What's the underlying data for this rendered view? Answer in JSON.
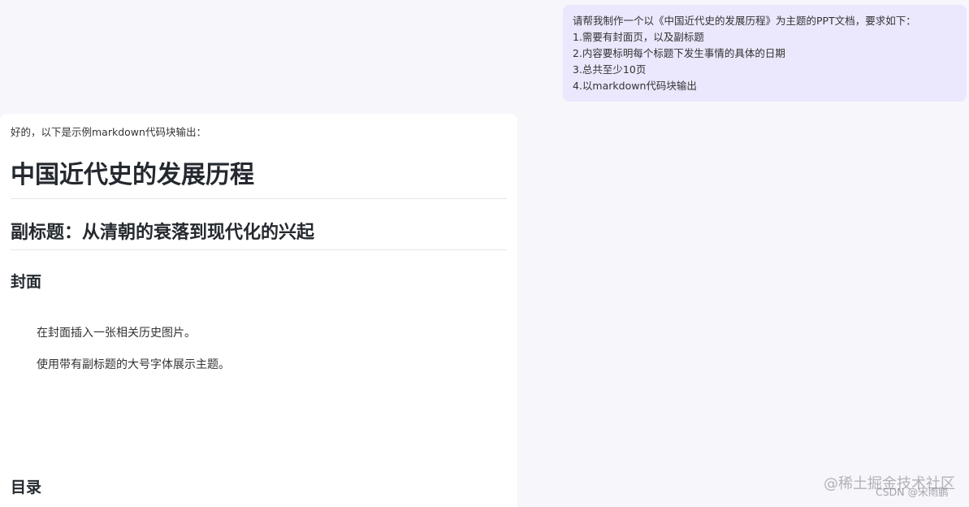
{
  "user_message": {
    "lines": [
      "请帮我制作一个以《中国近代史的发展历程》为主题的PPT文档，要求如下：",
      "1.需要有封面页，以及副标题",
      "2.内容要标明每个标题下发生事情的具体的日期",
      "3.总共至少10页",
      "4.以markdown代码块输出"
    ]
  },
  "assistant_message": {
    "intro": "好的，以下是示例markdown代码块输出：",
    "title": "中国近代史的发展历程",
    "subtitle": "副标题：从清朝的衰落到现代化的兴起",
    "cover_heading": "封面",
    "cover_points": [
      "在封面插入一张相关历史图片。",
      "使用带有副标题的大号字体展示主题。"
    ],
    "toc_heading": "目录"
  },
  "watermark": {
    "main": "@稀土掘金技术社区",
    "sub": "CSDN @宋雨鹏"
  }
}
